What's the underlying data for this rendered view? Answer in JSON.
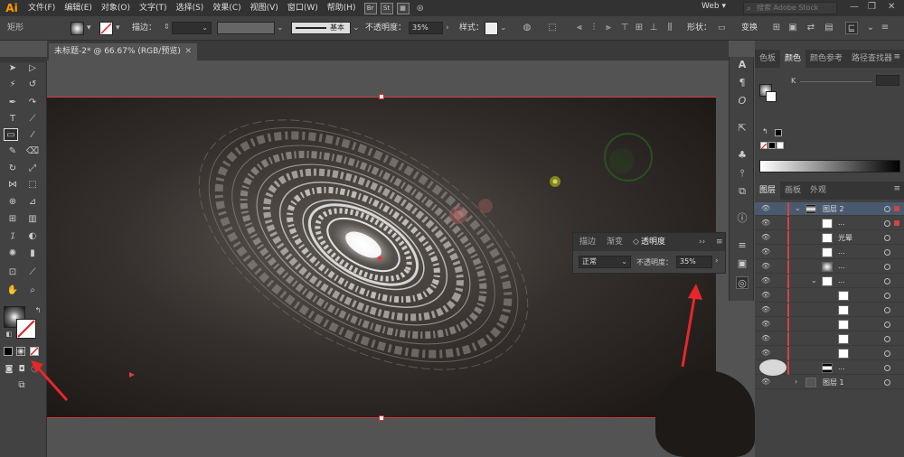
{
  "app": {
    "logo": "Ai",
    "workspace": "Web",
    "search_placeholder": "搜索 Adobe Stock"
  },
  "menu": [
    "文件(F)",
    "编辑(E)",
    "对象(O)",
    "文字(T)",
    "选择(S)",
    "效果(C)",
    "视图(V)",
    "窗口(W)",
    "帮助(H)"
  ],
  "bridge": [
    "Br",
    "St"
  ],
  "control": {
    "object_type": "矩形",
    "stroke_label": "描边：",
    "stroke_profile": "基本",
    "opacity_label": "不透明度：",
    "opacity_value": "35%",
    "style_label": "样式：",
    "shape_label": "形状：",
    "transform_label": "变换"
  },
  "document": {
    "tab_title": "未标题-2* @ 66.67% (RGB/预览)"
  },
  "right_panel": {
    "top_tabs": [
      "色板",
      "颜色",
      "颜色参考",
      "路径查找器"
    ],
    "active_top_tab": "颜色",
    "color_k_label": "K",
    "layer_tabs": [
      "图层",
      "画板",
      "外观"
    ],
    "layers": [
      {
        "name": "图层 2",
        "expanded": true,
        "selected": true
      },
      {
        "name": "..."
      },
      {
        "name": "光晕"
      },
      {
        "name": "..."
      },
      {
        "name": "..."
      },
      {
        "name": "..."
      },
      {
        "name": ""
      },
      {
        "name": ""
      },
      {
        "name": ""
      },
      {
        "name": ""
      },
      {
        "name": ""
      },
      {
        "name": "..."
      },
      {
        "name": "图层 1"
      }
    ]
  },
  "transparency_panel": {
    "tabs": [
      "描边",
      "渐变",
      "透明度"
    ],
    "active_tab": "透明度",
    "blend_mode": "正常",
    "opacity_label": "不透明度：",
    "opacity_value": "35%"
  },
  "colors": {
    "accent_orange": "#ff9a00",
    "artboard_edge": "#d23c3c",
    "annotation_red": "#e8262a"
  }
}
